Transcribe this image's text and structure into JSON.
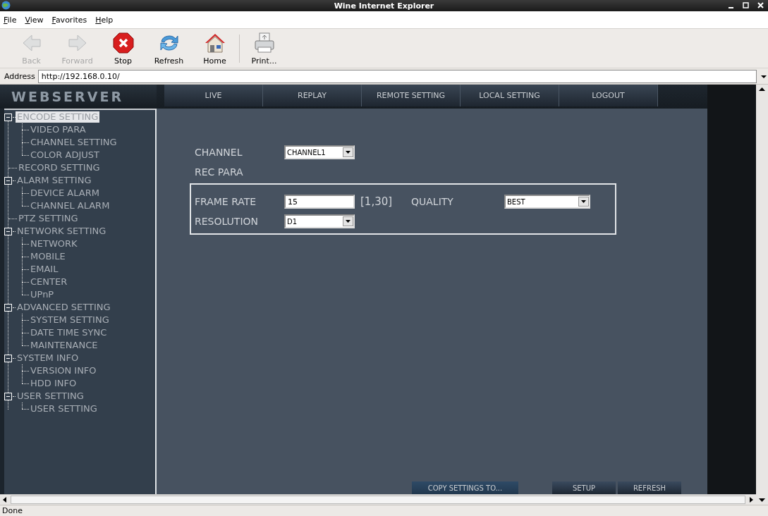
{
  "window": {
    "title": "Wine Internet Explorer"
  },
  "menu": [
    {
      "label": "File"
    },
    {
      "label": "View"
    },
    {
      "label": "Favorites"
    },
    {
      "label": "Help"
    }
  ],
  "toolbar": [
    {
      "label": "Back",
      "kind": "back",
      "disabled": true
    },
    {
      "label": "Forward",
      "kind": "forward",
      "disabled": true
    },
    {
      "label": "Stop",
      "kind": "stop",
      "disabled": false
    },
    {
      "label": "Refresh",
      "kind": "refresh",
      "disabled": false
    },
    {
      "label": "Home",
      "kind": "home",
      "disabled": false
    },
    {
      "label": "Print...",
      "kind": "print",
      "disabled": false
    }
  ],
  "address": {
    "label": "Address",
    "value": "http://192.168.0.10/"
  },
  "logo": "WEBSERVER",
  "nav": [
    "LIVE",
    "REPLAY",
    "REMOTE SETTING",
    "LOCAL SETTING",
    "LOGOUT"
  ],
  "tree": [
    {
      "label": "ENCODE SETTING",
      "selected": true,
      "expanded": true,
      "children": [
        {
          "label": "VIDEO PARA",
          "selected": false
        },
        {
          "label": "CHANNEL SETTING",
          "selected": false
        },
        {
          "label": "COLOR ADJUST",
          "selected": false
        }
      ]
    },
    {
      "label": "RECORD SETTING",
      "selected": false
    },
    {
      "label": "ALARM SETTING",
      "selected": false,
      "expanded": true,
      "children": [
        {
          "label": "DEVICE ALARM",
          "selected": false
        },
        {
          "label": "CHANNEL ALARM",
          "selected": false
        }
      ]
    },
    {
      "label": "PTZ SETTING",
      "selected": false
    },
    {
      "label": "NETWORK SETTING",
      "selected": false,
      "expanded": true,
      "children": [
        {
          "label": "NETWORK",
          "selected": false
        },
        {
          "label": "MOBILE",
          "selected": false
        },
        {
          "label": "EMAIL",
          "selected": false
        },
        {
          "label": "CENTER",
          "selected": false
        },
        {
          "label": "UPnP",
          "selected": false
        }
      ]
    },
    {
      "label": "ADVANCED SETTING",
      "selected": false,
      "expanded": true,
      "children": [
        {
          "label": "SYSTEM SETTING",
          "selected": false
        },
        {
          "label": "DATE TIME SYNC",
          "selected": false
        },
        {
          "label": "MAINTENANCE",
          "selected": false
        }
      ]
    },
    {
      "label": "SYSTEM INFO",
      "selected": false,
      "expanded": true,
      "children": [
        {
          "label": "VERSION INFO",
          "selected": false
        },
        {
          "label": "HDD INFO",
          "selected": false
        }
      ]
    },
    {
      "label": "USER SETTING",
      "selected": false,
      "expanded": true,
      "children": [
        {
          "label": "USER SETTING",
          "selected": false
        }
      ]
    }
  ],
  "form": {
    "channel": {
      "label": "CHANNEL",
      "value": "CHANNEL1"
    },
    "section": "REC PARA",
    "fields": [
      {
        "label": "FRAME RATE",
        "kind": "input",
        "value": "15",
        "hint": "[1,30]"
      },
      {
        "label": "QUALITY",
        "kind": "select",
        "value": "BEST"
      },
      {
        "label": "RESOLUTION",
        "kind": "select",
        "value": "D1"
      }
    ]
  },
  "buttons": [
    "COPY SETTINGS TO...",
    "SETUP",
    "REFRESH"
  ],
  "status_bar": "Done"
}
